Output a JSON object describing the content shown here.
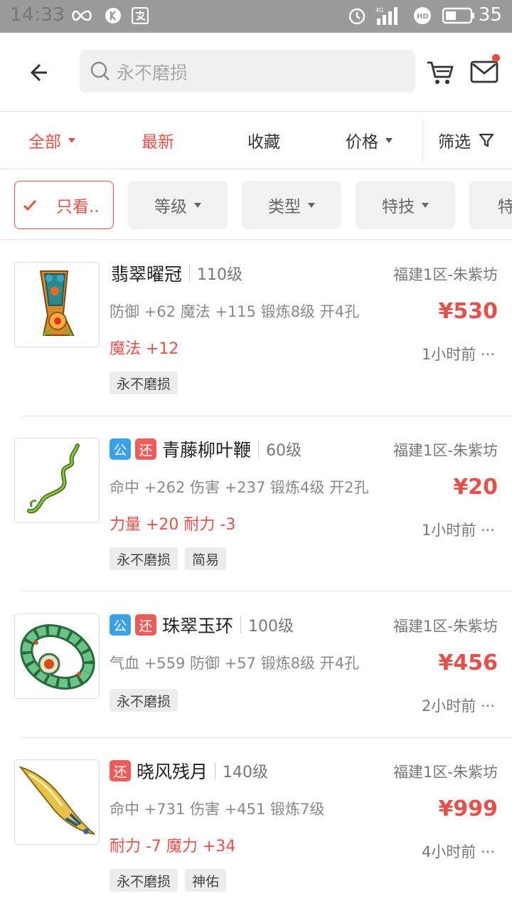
{
  "status_bar": {
    "time": "14:33",
    "battery": "35"
  },
  "search": {
    "placeholder": "永不磨损"
  },
  "sort_tabs": [
    {
      "label": "全部",
      "active": true,
      "caret": true
    },
    {
      "label": "最新",
      "active": true,
      "caret": false
    },
    {
      "label": "收藏",
      "active": false,
      "caret": false
    },
    {
      "label": "价格",
      "active": false,
      "caret": true
    }
  ],
  "filter_label": "筛选",
  "chips": [
    {
      "label": "只看..",
      "checked": true
    },
    {
      "label": "等级",
      "checked": false
    },
    {
      "label": "类型",
      "checked": false
    },
    {
      "label": "特技",
      "checked": false
    },
    {
      "label": "特",
      "checked": false
    }
  ],
  "items": [
    {
      "name": "翡翠曜冠",
      "level": "110级",
      "server": "福建1区-朱紫坊",
      "badges": [],
      "attrs": "防御 +62 魔法 +115 锻炼8级 开4孔",
      "price": "¥530",
      "extra": "魔法 +12",
      "time": "1小时前 ···",
      "tags": [
        "永不磨损"
      ]
    },
    {
      "name": "青藤柳叶鞭",
      "level": "60级",
      "server": "福建1区-朱紫坊",
      "badges": [
        "公",
        "还"
      ],
      "attrs": "命中 +262 伤害 +237 锻炼4级 开2孔",
      "price": "¥20",
      "extra": "力量 +20 耐力 -3",
      "time": "1小时前 ···",
      "tags": [
        "永不磨损",
        "简易"
      ]
    },
    {
      "name": "珠翠玉环",
      "level": "100级",
      "server": "福建1区-朱紫坊",
      "badges": [
        "公",
        "还"
      ],
      "attrs": "气血 +559 防御 +57 锻炼8级 开4孔",
      "price": "¥456",
      "extra": "",
      "time": "2小时前 ···",
      "tags": [
        "永不磨损"
      ]
    },
    {
      "name": "晓风残月",
      "level": "140级",
      "server": "福建1区-朱紫坊",
      "badges": [
        "还"
      ],
      "attrs": "命中 +731 伤害 +451 锻炼7级",
      "price": "¥999",
      "extra": "耐力 -7 魔力 +34",
      "time": "4小时前 ···",
      "tags": [
        "永不磨损",
        "神佑"
      ]
    }
  ]
}
